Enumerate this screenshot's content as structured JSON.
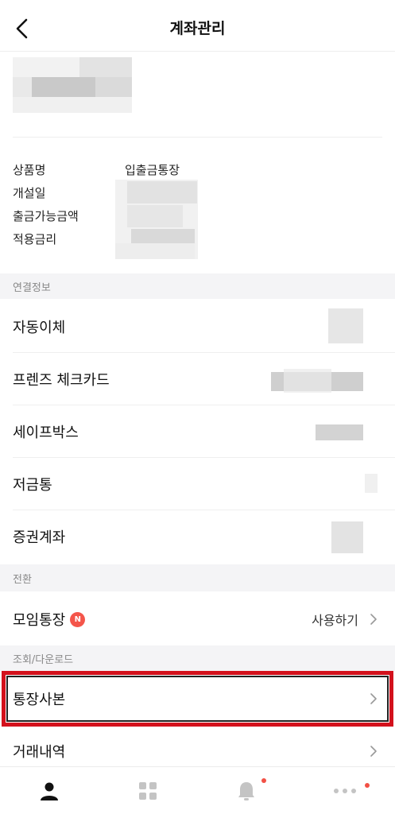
{
  "header": {
    "title": "계좌관리"
  },
  "account_info": {
    "labels": [
      "상품명",
      "개설일",
      "출금가능금액",
      "적용금리"
    ],
    "product_name": "입출금통장"
  },
  "sections": {
    "linked": "연결정보",
    "switch": "전환",
    "inquiry": "조회/다운로드"
  },
  "linked_items": [
    "자동이체",
    "프렌즈 체크카드",
    "세이프박스",
    "저금통",
    "증권계좌"
  ],
  "group_account": {
    "label": "모임통장",
    "badge": "N",
    "action": "사용하기"
  },
  "inquiry_items": [
    "통장사본",
    "거래내역"
  ],
  "colors": {
    "highlight": "#d3111c",
    "badge": "#f4554a",
    "section_bg": "#f4f4f6"
  }
}
